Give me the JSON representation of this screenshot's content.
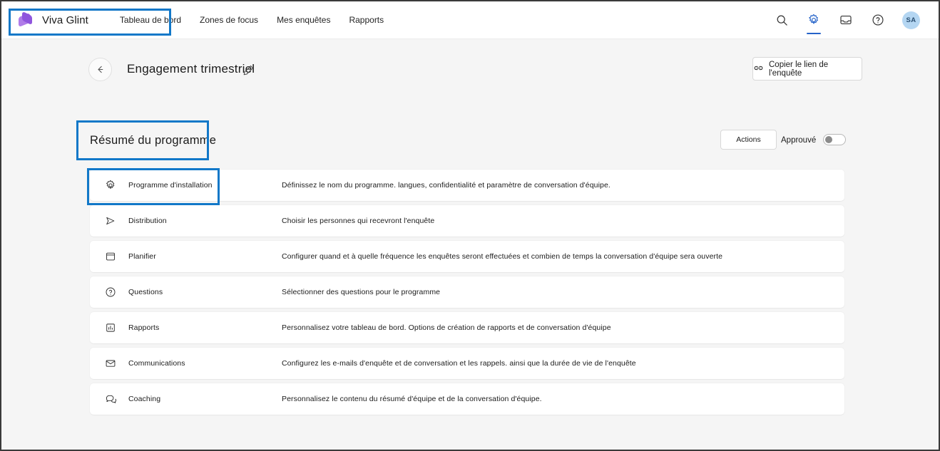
{
  "topbar": {
    "brand": "Viva Glint",
    "logo_icon": "viva-glint-diamond-logo",
    "nav_links": [
      {
        "label": "Tableau de bord"
      },
      {
        "label": "Zones de focus"
      },
      {
        "label": "Mes enquêtes"
      },
      {
        "label": "Rapports"
      }
    ],
    "icons": [
      {
        "name": "search-icon",
        "active": false
      },
      {
        "name": "gear-icon",
        "active": true
      },
      {
        "name": "inbox-icon",
        "active": false
      },
      {
        "name": "help-icon",
        "active": false
      }
    ],
    "avatar_initials": "SA",
    "accent_color": "#2563c9"
  },
  "page_header": {
    "back_icon": "arrow-left-icon",
    "title": "Engagement trimestriel",
    "edit_icon": "pencil-icon",
    "copy_link": {
      "icon": "link-icon",
      "label": "Copier le lien de l'enquête"
    }
  },
  "section": {
    "title": "Résumé du programme",
    "actions_label": "Actions",
    "approved_label": "Approuvé",
    "approved_on": false
  },
  "rows": [
    {
      "icon": "gear-icon",
      "label": "Programme d'installation",
      "desc": "Définissez le nom du programme. langues, confidentialité et paramètre de conversation d'équipe."
    },
    {
      "icon": "send-icon",
      "label": "Distribution",
      "desc": "Choisir les personnes qui recevront l'enquête"
    },
    {
      "icon": "calendar-icon",
      "label": "Planifier",
      "desc": "Configurer quand et à quelle fréquence les enquêtes seront effectuées et combien de temps la conversation d'équipe sera ouverte"
    },
    {
      "icon": "help-icon",
      "label": "Questions",
      "desc": "Sélectionner des questions pour le programme"
    },
    {
      "icon": "chart-icon",
      "label": "Rapports",
      "desc": "Personnalisez votre tableau de bord. Options de création de rapports et de conversation d'équipe"
    },
    {
      "icon": "mail-icon",
      "label": "Communications",
      "desc": "Configurez les e-mails d'enquête et de conversation et les rappels. ainsi que la durée de vie de l'enquête"
    },
    {
      "icon": "chat-icon",
      "label": "Coaching",
      "desc": "Personnalisez le contenu du résumé d'équipe et de la conversation d'équipe."
    }
  ],
  "annotations": {
    "highlight_color": "#1278c8",
    "boxes": [
      {
        "target": "brand-and-nav"
      },
      {
        "target": "section-title"
      },
      {
        "target": "row-programme-installation"
      }
    ]
  }
}
